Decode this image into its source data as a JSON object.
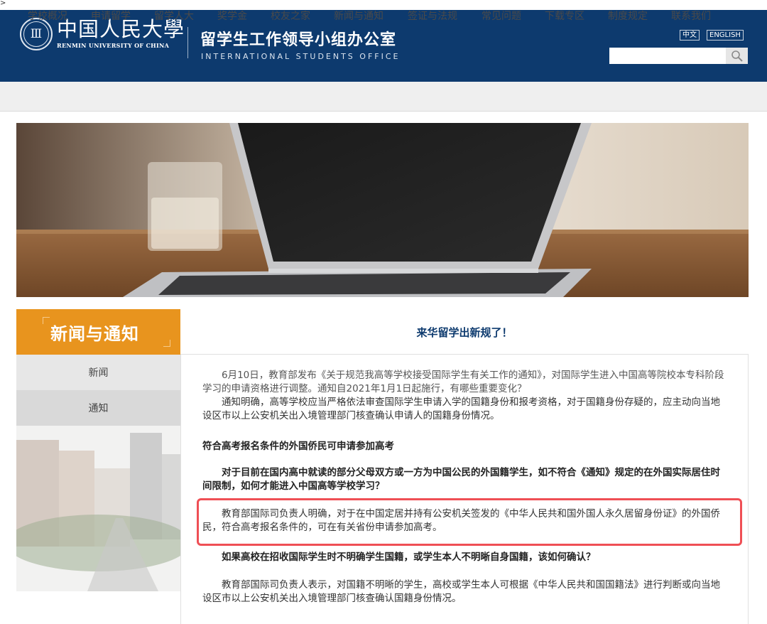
{
  "stray_mark": ">",
  "header": {
    "university_cn": "中国人民大學",
    "university_en": "RENMIN UNIVERSITY OF CHINA",
    "office_cn": "留学生工作领导小组办公室",
    "office_en": "INTERNATIONAL STUDENTS OFFICE",
    "lang_zh": "中文",
    "lang_en": "ENGLISH",
    "search_placeholder": "",
    "colors": {
      "header_bg": "#0d3a6e",
      "accent": "#e8941e",
      "highlight": "#ef4f55"
    }
  },
  "nav": {
    "items": [
      "学校概况",
      "申请留学",
      "留学人大",
      "奖学金",
      "校友之家",
      "新闻与通知",
      "签证与法规",
      "常见问题",
      "下载专区",
      "制度规定",
      "联系我们"
    ]
  },
  "sidebar": {
    "title": "新闻与通知",
    "items": [
      "新闻",
      "通知"
    ]
  },
  "article": {
    "title": "来华留学出新规了！",
    "paragraphs": [
      "6月10日，教育部发布《关于规范我高等学校接受国际学生有关工作的通知》，对国际学生进入中国高等院校本专科阶段学习的申请资格进行调整。通知自2021年1月1日起施行，有哪些重要变化？",
      "通知明确，高等学校应当严格依法审查国际学生申请入学的国籍身份和报考资格，对于国籍身份存疑的，应主动向当地设区市以上公安机关出入境管理部门核查确认申请人的国籍身份情况。",
      "符合高考报名条件的外国侨民可申请参加高考",
      "对于目前在国内高中就读的部分父母双方或一方为中国公民的外国籍学生，如不符合《通知》规定的在外国实际居住时间限制，如何才能进入中国高等学校学习？",
      "教育部国际司负责人明确，对于在中国定居并持有公安机关签发的《中华人民共和国外国人永久居留身份证》的外国侨民，符合高考报名条件的，可在有关省份申请参加高考。",
      "如果高校在招收国际学生时不明确学生国籍，或学生本人不明晰自身国籍，该如何确认？",
      "教育部国际司负责人表示，对国籍不明晰的学生，高校或学生本人可根据《中华人民共和国国籍法》进行判断或向当地设区市以上公安机关出入境管理部门核查确认国籍身份情况。"
    ]
  }
}
